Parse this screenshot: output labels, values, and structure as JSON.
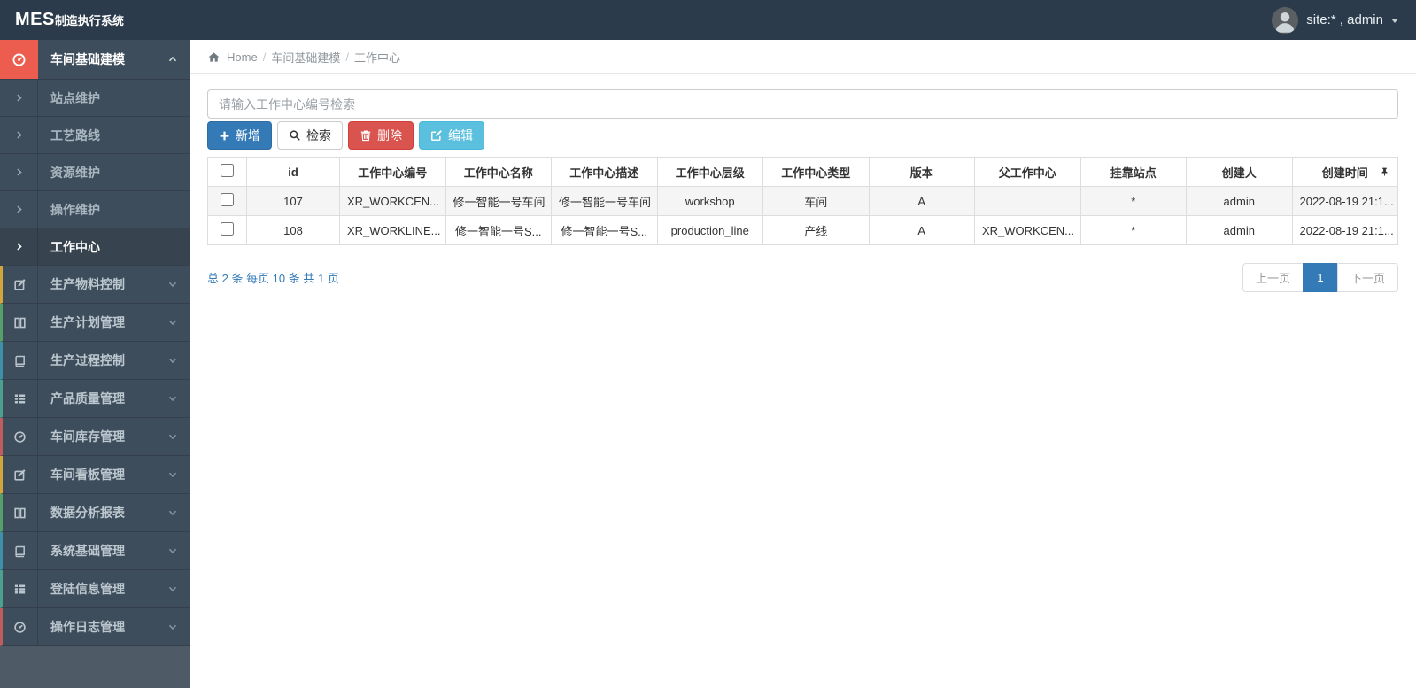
{
  "app": {
    "brand_bold": "MES",
    "brand_rest": "制造执行系统",
    "user_label": "site:* , admin"
  },
  "colors": {
    "navbar_bg": "#2c3b4b",
    "sidebar_bg": "#3e4d5b",
    "active_menu_icon_bg": "#ec5d50",
    "primary": "#337ab7",
    "danger": "#d9534f",
    "info": "#5bc0de",
    "pagination_active": "#337ab7"
  },
  "sidebar": {
    "parent_active": {
      "label": "车间基础建模",
      "icon": "gauge-icon",
      "chevron": "chevron-up-icon"
    },
    "sub_items": [
      {
        "label": "站点维护",
        "active": false
      },
      {
        "label": "工艺路线",
        "active": false
      },
      {
        "label": "资源维护",
        "active": false
      },
      {
        "label": "操作维护",
        "active": false
      },
      {
        "label": "工作中心",
        "active": true
      }
    ],
    "items": [
      {
        "label": "生产物料控制",
        "icon": "edit-square-icon",
        "accent": "#d2a63c"
      },
      {
        "label": "生产计划管理",
        "icon": "columns-icon",
        "accent": "#55a06a"
      },
      {
        "label": "生产过程控制",
        "icon": "book-icon",
        "accent": "#3e8fa8"
      },
      {
        "label": "产品质量管理",
        "icon": "list-icon",
        "accent": "#4ba08e"
      },
      {
        "label": "车间库存管理",
        "icon": "gauge-icon",
        "accent": "#c05c5c"
      },
      {
        "label": "车间看板管理",
        "icon": "edit-square-icon",
        "accent": "#d2a63c"
      },
      {
        "label": "数据分析报表",
        "icon": "columns-icon",
        "accent": "#55a06a"
      },
      {
        "label": "系统基础管理",
        "icon": "book-icon",
        "accent": "#3e8fa8"
      },
      {
        "label": "登陆信息管理",
        "icon": "list-icon",
        "accent": "#4ba08e"
      },
      {
        "label": "操作日志管理",
        "icon": "gauge-icon",
        "accent": "#c05c5c"
      }
    ]
  },
  "breadcrumb": {
    "home": "Home",
    "separator": "/",
    "level1": "车间基础建模",
    "level2": "工作中心"
  },
  "search": {
    "placeholder": "请输入工作中心编号检索"
  },
  "toolbar": {
    "add_label": "新增",
    "search_label": "检索",
    "delete_label": "删除",
    "edit_label": "编辑"
  },
  "table": {
    "headers": [
      "id",
      "工作中心编号",
      "工作中心名称",
      "工作中心描述",
      "工作中心层级",
      "工作中心类型",
      "版本",
      "父工作中心",
      "挂靠站点",
      "创建人",
      "创建时间"
    ],
    "rows": [
      {
        "id": "107",
        "code": "XR_WORKCEN...",
        "name": "修一智能一号车间",
        "desc": "修一智能一号车间",
        "level": "workshop",
        "type": "车间",
        "version": "A",
        "parent": "",
        "station": "*",
        "creator": "admin",
        "created": "2022-08-19 21:1..."
      },
      {
        "id": "108",
        "code": "XR_WORKLINE...",
        "name": "修一智能一号S...",
        "desc": "修一智能一号S...",
        "level": "production_line",
        "type": "产线",
        "version": "A",
        "parent": "XR_WORKCEN...",
        "station": "*",
        "creator": "admin",
        "created": "2022-08-19 21:1..."
      }
    ]
  },
  "pagination": {
    "summary": "总 2 条  每页 10 条  共 1 页",
    "prev_label": "上一页",
    "current_page": "1",
    "next_label": "下一页"
  }
}
